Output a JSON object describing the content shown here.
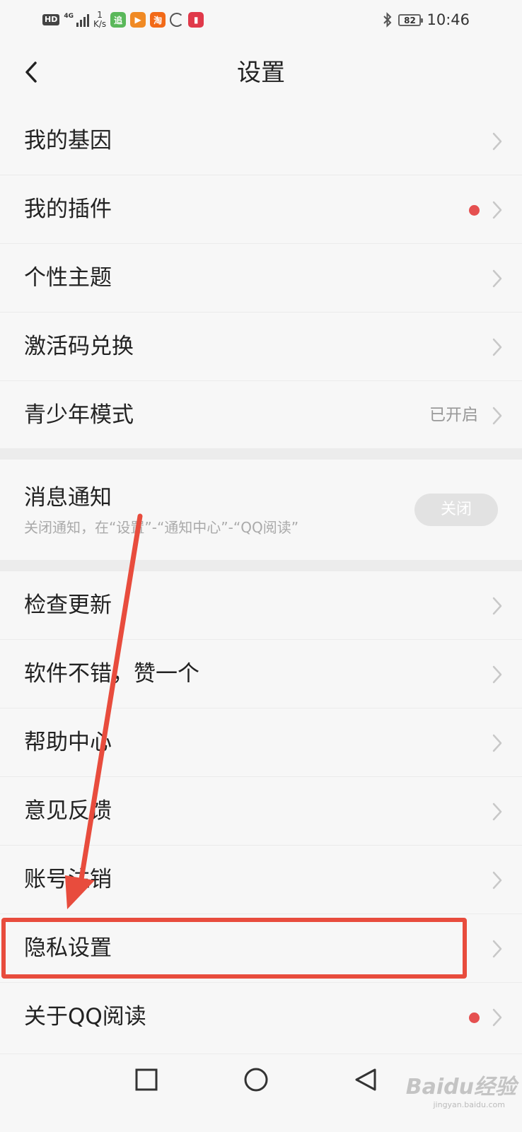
{
  "status_bar": {
    "hd": "HD",
    "network": "4G",
    "speed_top": "1",
    "speed_unit": "K/s",
    "app_icons": [
      {
        "name": "qidian",
        "glyph": "追",
        "color": "#5ab85a"
      },
      {
        "name": "video",
        "glyph": "▶",
        "color": "#f08a24"
      },
      {
        "name": "taobao",
        "glyph": "淘",
        "color": "#f26a18"
      },
      {
        "name": "book",
        "glyph": "▮",
        "color": "#e0394a"
      }
    ],
    "battery": "82",
    "time": "10:46"
  },
  "header": {
    "title": "设置"
  },
  "group1": [
    {
      "label": "我的基因",
      "dot": false,
      "value": ""
    },
    {
      "label": "我的插件",
      "dot": true,
      "value": ""
    },
    {
      "label": "个性主题",
      "dot": false,
      "value": ""
    },
    {
      "label": "激活码兑换",
      "dot": false,
      "value": ""
    },
    {
      "label": "青少年模式",
      "dot": false,
      "value": "已开启"
    }
  ],
  "notification": {
    "title": "消息通知",
    "subtitle": "关闭通知，在“设置”-“通知中心”-“QQ阅读”",
    "toggle_label": "关闭"
  },
  "group2": [
    {
      "label": "检查更新",
      "dot": false
    },
    {
      "label": "软件不错，赞一个",
      "dot": false
    },
    {
      "label": "帮助中心",
      "dot": false
    },
    {
      "label": "意见反馈",
      "dot": false
    },
    {
      "label": "账号注销",
      "dot": false
    },
    {
      "label": "隐私设置",
      "dot": false
    },
    {
      "label": "关于QQ阅读",
      "dot": true
    }
  ],
  "watermark": {
    "brand": "Baidu经验",
    "url": "jingyan.baidu.com"
  },
  "colors": {
    "accent_red": "#e84c3d",
    "dot_red": "#e55050"
  }
}
